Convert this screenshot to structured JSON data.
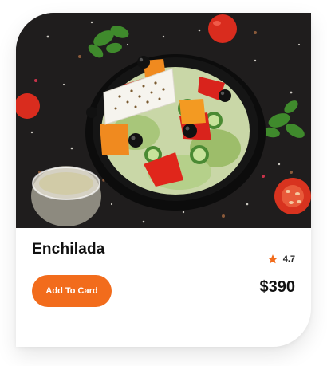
{
  "product": {
    "name": "Enchilada",
    "rating": "4.7",
    "price": "$390",
    "add_button_label": "Add To Card",
    "image_icon": "salad-bowl-photo"
  },
  "colors": {
    "accent": "#f26c1c",
    "star": "#f26c1c",
    "photo_background": "#1f1d1d",
    "text": "#111111"
  }
}
